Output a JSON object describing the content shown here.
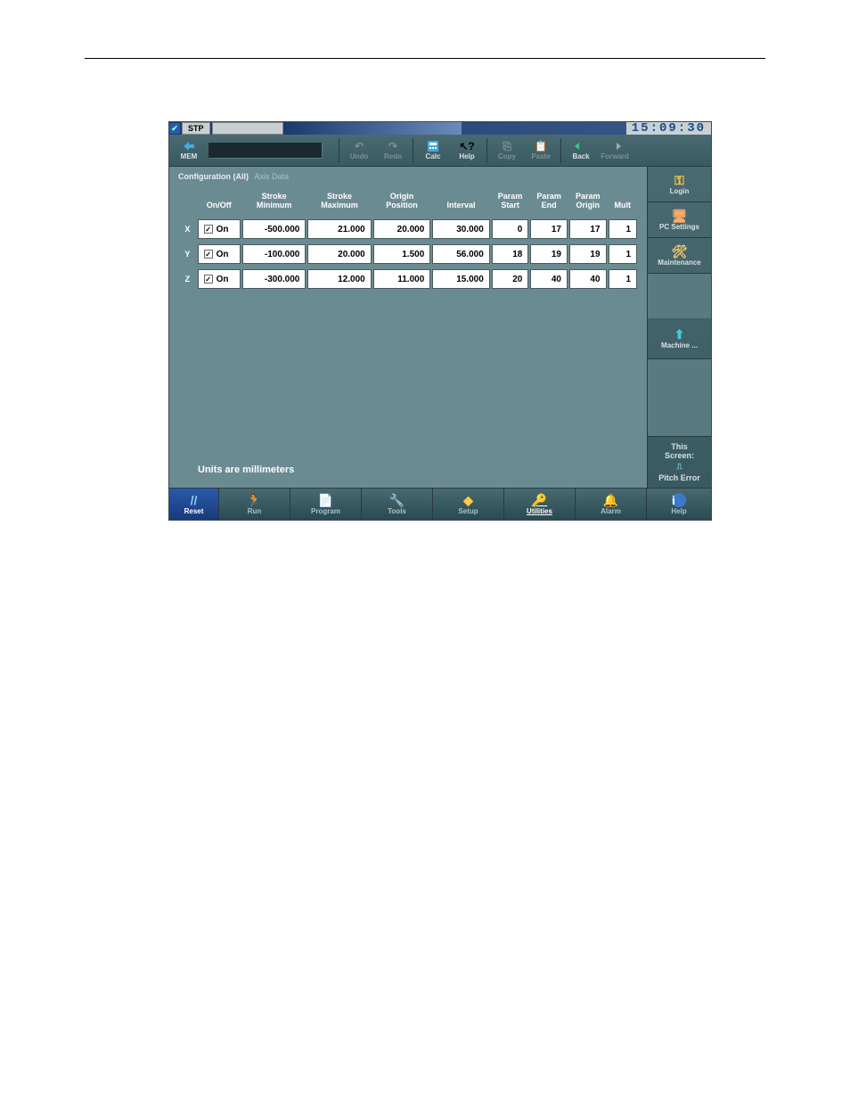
{
  "titlebar": {
    "status": "STP",
    "clock": "15:09:30"
  },
  "toolbar": {
    "mem": "MEM",
    "undo": "Undo",
    "redo": "Redo",
    "calc": "Calc",
    "help": "Help",
    "copy": "Copy",
    "paste": "Paste",
    "back": "Back",
    "forward": "Forward"
  },
  "breadcrumb": {
    "main": "Configuration (All)",
    "sub": "Axis Data"
  },
  "table": {
    "headers": {
      "onoff": "On/Off",
      "stroke_min": "Stroke Minimum",
      "stroke_max": "Stroke Maximum",
      "origin": "Origin Position",
      "interval": "Interval",
      "pstart": "Param Start",
      "pend": "Param End",
      "porigin": "Param Origin",
      "mult": "Mult"
    },
    "rows": [
      {
        "axis": "X",
        "on": "On",
        "smin": "-500.000",
        "smax": "21.000",
        "origin": "20.000",
        "interval": "30.000",
        "pstart": "0",
        "pend": "17",
        "porigin": "17",
        "mult": "1"
      },
      {
        "axis": "Y",
        "on": "On",
        "smin": "-100.000",
        "smax": "20.000",
        "origin": "1.500",
        "interval": "56.000",
        "pstart": "18",
        "pend": "19",
        "porigin": "19",
        "mult": "1"
      },
      {
        "axis": "Z",
        "on": "On",
        "smin": "-300.000",
        "smax": "12.000",
        "origin": "11.000",
        "interval": "15.000",
        "pstart": "20",
        "pend": "40",
        "porigin": "40",
        "mult": "1"
      }
    ]
  },
  "units_note": "Units are millimeters",
  "right": {
    "login": "Login",
    "pcsettings": "PC Settings",
    "maintenance": "Maintenance",
    "machine": "Machine ...",
    "this_screen_1": "This",
    "this_screen_2": "Screen:",
    "this_screen_3": "Pitch Error"
  },
  "bottom": {
    "reset": "Reset",
    "run": "Run",
    "program": "Program",
    "tools": "Tools",
    "setup": "Setup",
    "utilities": "Utilities",
    "alarm": "Alarm",
    "help": "Help"
  }
}
